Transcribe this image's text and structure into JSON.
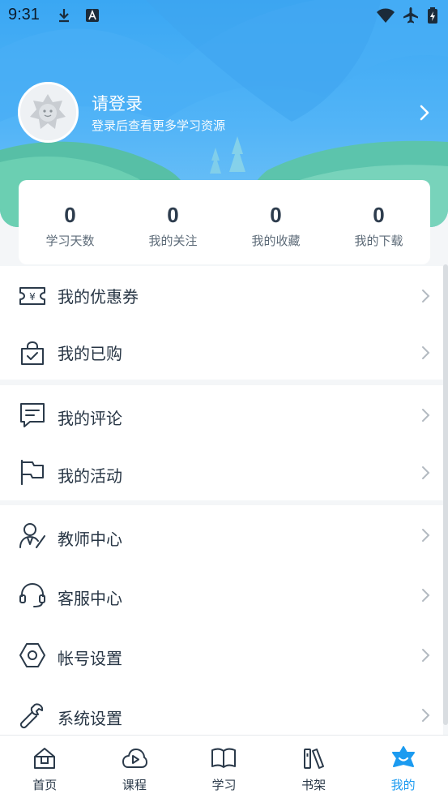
{
  "status_bar": {
    "time": "9:31"
  },
  "profile": {
    "title": "请登录",
    "subtitle": "登录后查看更多学习资源"
  },
  "stats": [
    {
      "value": "0",
      "label": "学习天数"
    },
    {
      "value": "0",
      "label": "我的关注"
    },
    {
      "value": "0",
      "label": "我的收藏"
    },
    {
      "value": "0",
      "label": "我的下载"
    }
  ],
  "menu": {
    "group1": [
      {
        "label": "我的优惠券",
        "icon": "coupon-icon"
      },
      {
        "label": "我的已购",
        "icon": "shopping-bag-icon"
      }
    ],
    "group2": [
      {
        "label": "我的评论",
        "icon": "comment-icon"
      },
      {
        "label": "我的活动",
        "icon": "flag-icon"
      }
    ],
    "group3": [
      {
        "label": "教师中心",
        "icon": "teacher-icon"
      },
      {
        "label": "客服中心",
        "icon": "headset-icon"
      },
      {
        "label": "帐号设置",
        "icon": "hexagon-settings-icon"
      },
      {
        "label": "系统设置",
        "icon": "wrench-icon"
      }
    ]
  },
  "tabs": [
    {
      "label": "首页",
      "icon": "home-icon"
    },
    {
      "label": "课程",
      "icon": "play-cloud-icon"
    },
    {
      "label": "学习",
      "icon": "book-open-icon"
    },
    {
      "label": "书架",
      "icon": "bookshelf-icon"
    },
    {
      "label": "我的",
      "icon": "profile-star-icon",
      "active": true
    }
  ],
  "colors": {
    "accent": "#1c9bf0",
    "hero_top": "#3aa7f3",
    "icon_stroke": "#2b3a4a"
  }
}
